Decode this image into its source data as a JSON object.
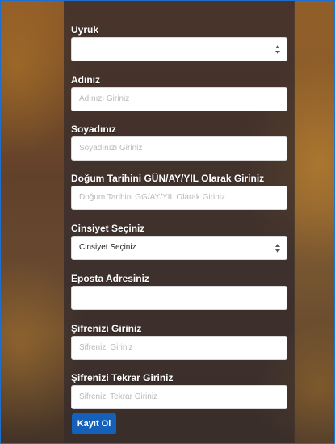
{
  "form": {
    "uyruk": {
      "label": "Uyruk",
      "value": ""
    },
    "adiniz": {
      "label": "Adınız",
      "placeholder": "Adınızı Giriniz"
    },
    "soyadiniz": {
      "label": "Soyadınız",
      "placeholder": "Soyadınızı Giriniz"
    },
    "dogum_tarihi": {
      "label": "Doğum Tarihini GÜN/AY/YIL Olarak Giriniz",
      "placeholder": "Doğum Tarihini GG/AY/YIL Olarak Giriniz"
    },
    "cinsiyet": {
      "label": "Cinsiyet Seçiniz",
      "value": "Cinsiyet Seçiniz"
    },
    "eposta": {
      "label": "Eposta Adresiniz",
      "placeholder": ""
    },
    "sifre": {
      "label": "Şifrenizi Giriniz",
      "placeholder": "Şifrenizi Giriniz"
    },
    "sifre_tekrar": {
      "label": "Şifrenizi Tekrar Giriniz",
      "placeholder": "Şifrenizi Tekrar Giriniz"
    },
    "submit_label": "Kayıt Ol"
  },
  "colors": {
    "frame_border": "#1f6fd0",
    "submit_bg": "#1560b8",
    "placeholder_text": "#b9b9b9"
  }
}
